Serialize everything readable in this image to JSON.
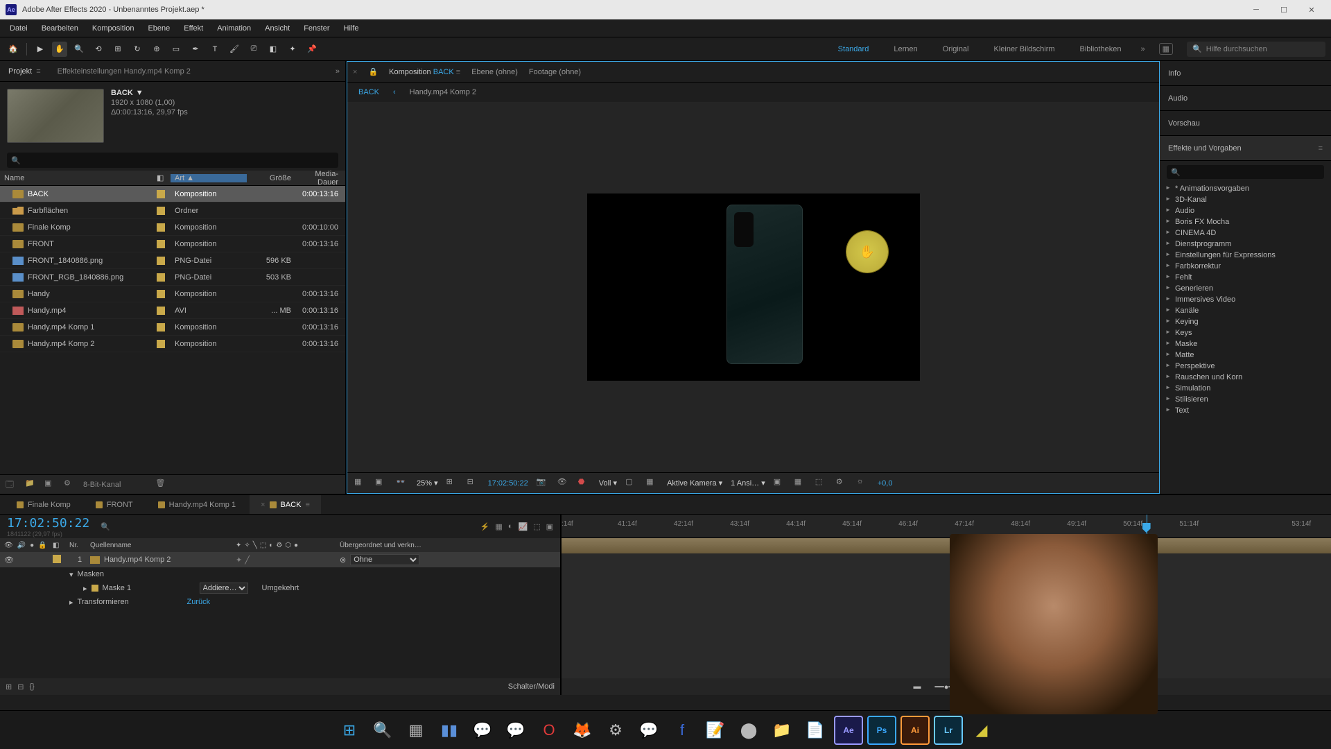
{
  "title": "Adobe After Effects 2020 - Unbenanntes Projekt.aep *",
  "menu": [
    "Datei",
    "Bearbeiten",
    "Komposition",
    "Ebene",
    "Effekt",
    "Animation",
    "Ansicht",
    "Fenster",
    "Hilfe"
  ],
  "workspaces": {
    "standard": "Standard",
    "lernen": "Lernen",
    "original": "Original",
    "kleiner": "Kleiner Bildschirm",
    "biblio": "Bibliotheken"
  },
  "help_search_placeholder": "Hilfe durchsuchen",
  "project": {
    "tab": "Projekt",
    "settings_tab": "Effekteinstellungen  Handy.mp4 Komp 2",
    "selected_name": "BACK",
    "dims": "1920 x 1080 (1,00)",
    "dur": "Δ0:00:13:16, 29,97 fps",
    "columns": {
      "name": "Name",
      "art": "Art",
      "size": "Größe",
      "dur": "Media-Dauer"
    },
    "bitdepth": "8-Bit-Kanal",
    "items": [
      {
        "name": "BACK",
        "type": "Komposition",
        "size": "",
        "dur": "0:00:13:16",
        "icon": "comp",
        "selected": true
      },
      {
        "name": "Farbflächen",
        "type": "Ordner",
        "size": "",
        "dur": "",
        "icon": "folder"
      },
      {
        "name": "Finale Komp",
        "type": "Komposition",
        "size": "",
        "dur": "0:00:10:00",
        "icon": "comp"
      },
      {
        "name": "FRONT",
        "type": "Komposition",
        "size": "",
        "dur": "0:00:13:16",
        "icon": "comp"
      },
      {
        "name": "FRONT_1840886.png",
        "type": "PNG-Datei",
        "size": "596 KB",
        "dur": "",
        "icon": "png"
      },
      {
        "name": "FRONT_RGB_1840886.png",
        "type": "PNG-Datei",
        "size": "503 KB",
        "dur": "",
        "icon": "png"
      },
      {
        "name": "Handy",
        "type": "Komposition",
        "size": "",
        "dur": "0:00:13:16",
        "icon": "comp"
      },
      {
        "name": "Handy.mp4",
        "type": "AVI",
        "size": "... MB",
        "dur": "0:00:13:16",
        "icon": "avi"
      },
      {
        "name": "Handy.mp4 Komp 1",
        "type": "Komposition",
        "size": "",
        "dur": "0:00:13:16",
        "icon": "comp"
      },
      {
        "name": "Handy.mp4 Komp 2",
        "type": "Komposition",
        "size": "",
        "dur": "0:00:13:16",
        "icon": "comp"
      }
    ]
  },
  "comp": {
    "tab_prefix": "Komposition",
    "tab_name": "BACK",
    "tab_layer": "Ebene  (ohne)",
    "tab_footage": "Footage  (ohne)",
    "crumb1": "BACK",
    "crumb2": "Handy.mp4 Komp 2",
    "zoom": "25%",
    "timecode": "17:02:50:22",
    "resolution": "Voll",
    "camera": "Aktive Kamera",
    "views": "1 Ansi…",
    "offset": "+0,0"
  },
  "right": {
    "info": "Info",
    "audio": "Audio",
    "vorschau": "Vorschau",
    "effekte": "Effekte und Vorgaben",
    "items": [
      "* Animationsvorgaben",
      "3D-Kanal",
      "Audio",
      "Boris FX Mocha",
      "CINEMA 4D",
      "Dienstprogramm",
      "Einstellungen für Expressions",
      "Farbkorrektur",
      "Fehlt",
      "Generieren",
      "Immersives Video",
      "Kanäle",
      "Keying",
      "Keys",
      "Maske",
      "Matte",
      "Perspektive",
      "Rauschen und Korn",
      "Simulation",
      "Stilisieren",
      "Text"
    ]
  },
  "timeline": {
    "tabs": [
      {
        "label": "Finale Komp"
      },
      {
        "label": "FRONT"
      },
      {
        "label": "Handy.mp4 Komp 1"
      },
      {
        "label": "BACK",
        "active": true
      }
    ],
    "timecode": "17:02:50:22",
    "subframe": "1841122 (29,97 fps)",
    "head": {
      "nr": "Nr.",
      "quelle": "Quellenname",
      "parent": "Übergeordnet und verkn…"
    },
    "layer": {
      "num": "1",
      "name": "Handy.mp4 Komp 2",
      "parent_mode": "Ohne"
    },
    "masken": "Masken",
    "maske1": "Maske 1",
    "mask_mode": "Addiere…",
    "umgekehrt": "Umgekehrt",
    "transform": "Transformieren",
    "reset": "Zurück",
    "footer": "Schalter/Modi",
    "ticks": [
      ":14f",
      "41:14f",
      "42:14f",
      "43:14f",
      "44:14f",
      "45:14f",
      "46:14f",
      "47:14f",
      "48:14f",
      "49:14f",
      "50:14f",
      "51:14f",
      "",
      "53:14f"
    ]
  }
}
